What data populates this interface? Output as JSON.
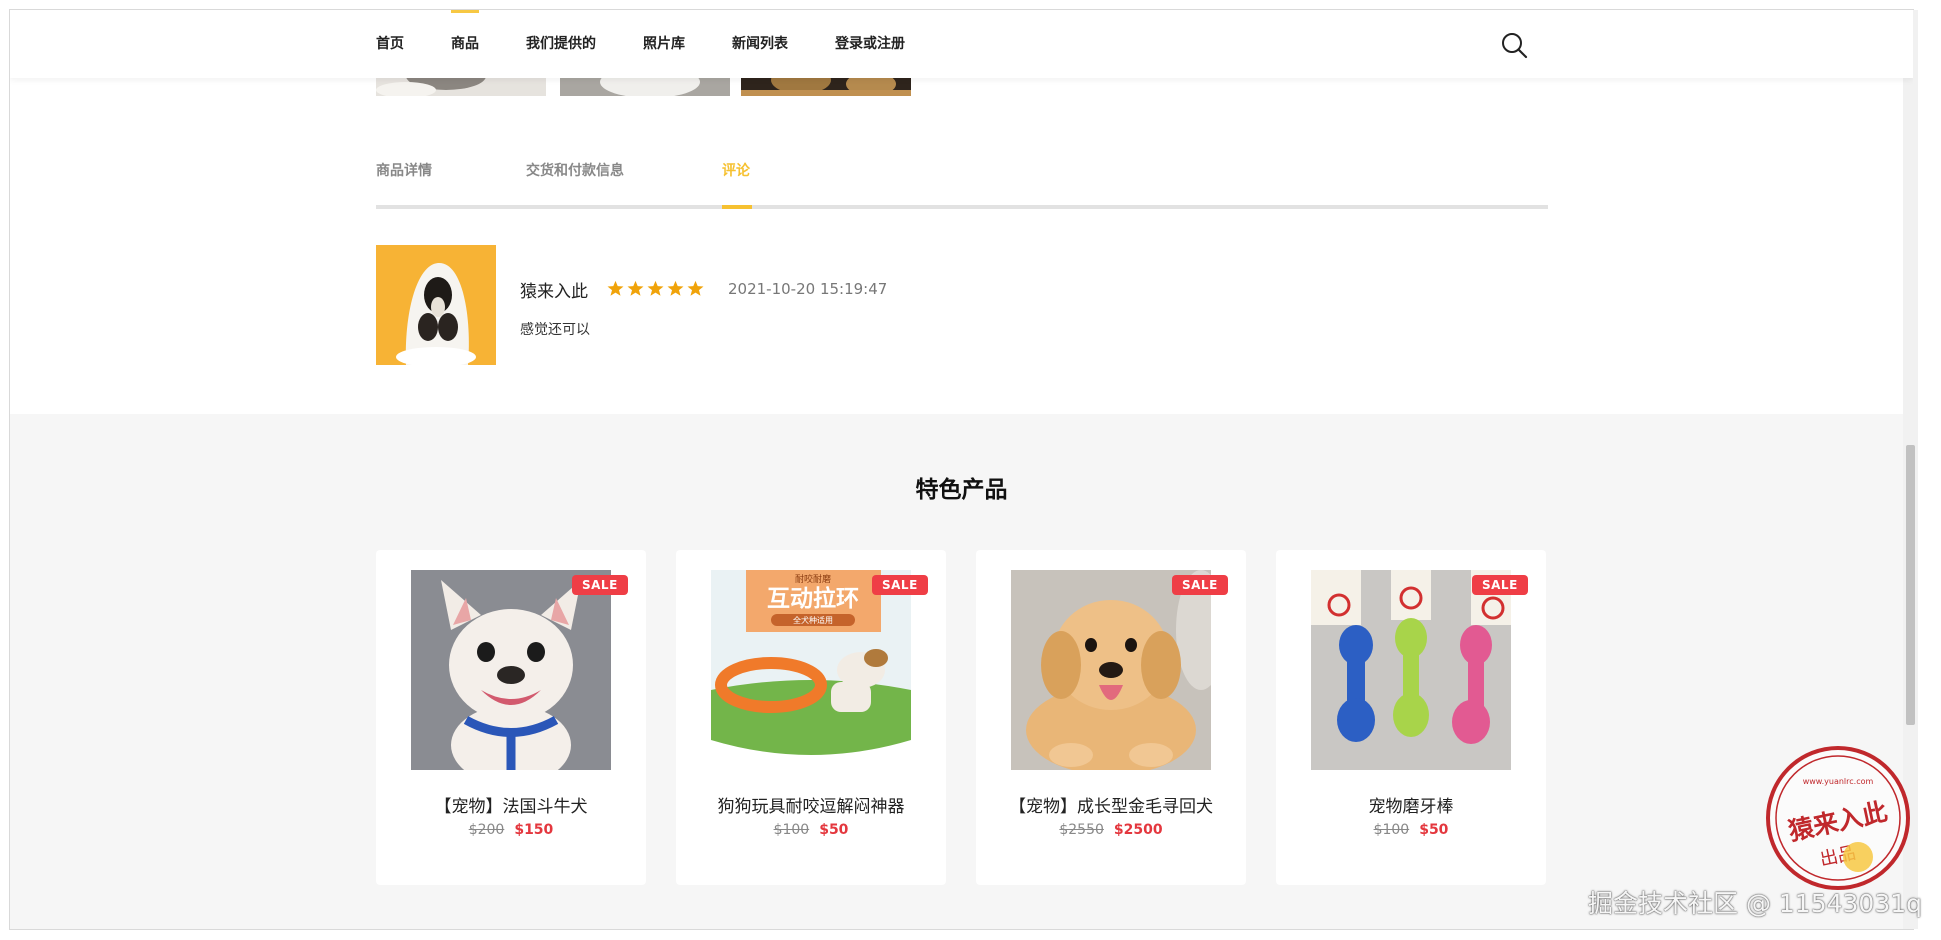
{
  "nav": {
    "items": [
      "首页",
      "商品",
      "我们提供的",
      "照片库",
      "新闻列表",
      "登录或注册"
    ],
    "active_index": 1
  },
  "tabs": {
    "items": [
      "商品详情",
      "交货和付款信息",
      "评论"
    ],
    "active_index": 2
  },
  "review": {
    "author": "猿来入此",
    "rating": 5,
    "date": "2021-10-20 15:19:47",
    "text": "感觉还可以"
  },
  "featured": {
    "title": "特色产品",
    "products": [
      {
        "name": "【宠物】法国斗牛犬",
        "old_price": "$200",
        "price": "$150",
        "badge": "SALE"
      },
      {
        "name": "狗狗玩具耐咬逗解闷神器",
        "old_price": "$100",
        "price": "$50",
        "badge": "SALE"
      },
      {
        "name": "【宠物】成长型金毛寻回犬",
        "old_price": "$2550",
        "price": "$2500",
        "badge": "SALE"
      },
      {
        "name": "宠物磨牙棒",
        "old_price": "$100",
        "price": "$50",
        "badge": "SALE"
      }
    ]
  },
  "toy_banner": {
    "top": "耐咬耐磨",
    "main": "互动拉环",
    "sub": "全犬种适用"
  },
  "watermark": {
    "stamp_text": "猿来入此",
    "stamp_sub": "出品",
    "stamp_url": "www.yuanlrc.com",
    "site_text": "掘金技术社区 @ 11543031q"
  },
  "colors": {
    "accent": "#f6c131",
    "sale": "#ef3e46",
    "price": "#e4373e"
  }
}
